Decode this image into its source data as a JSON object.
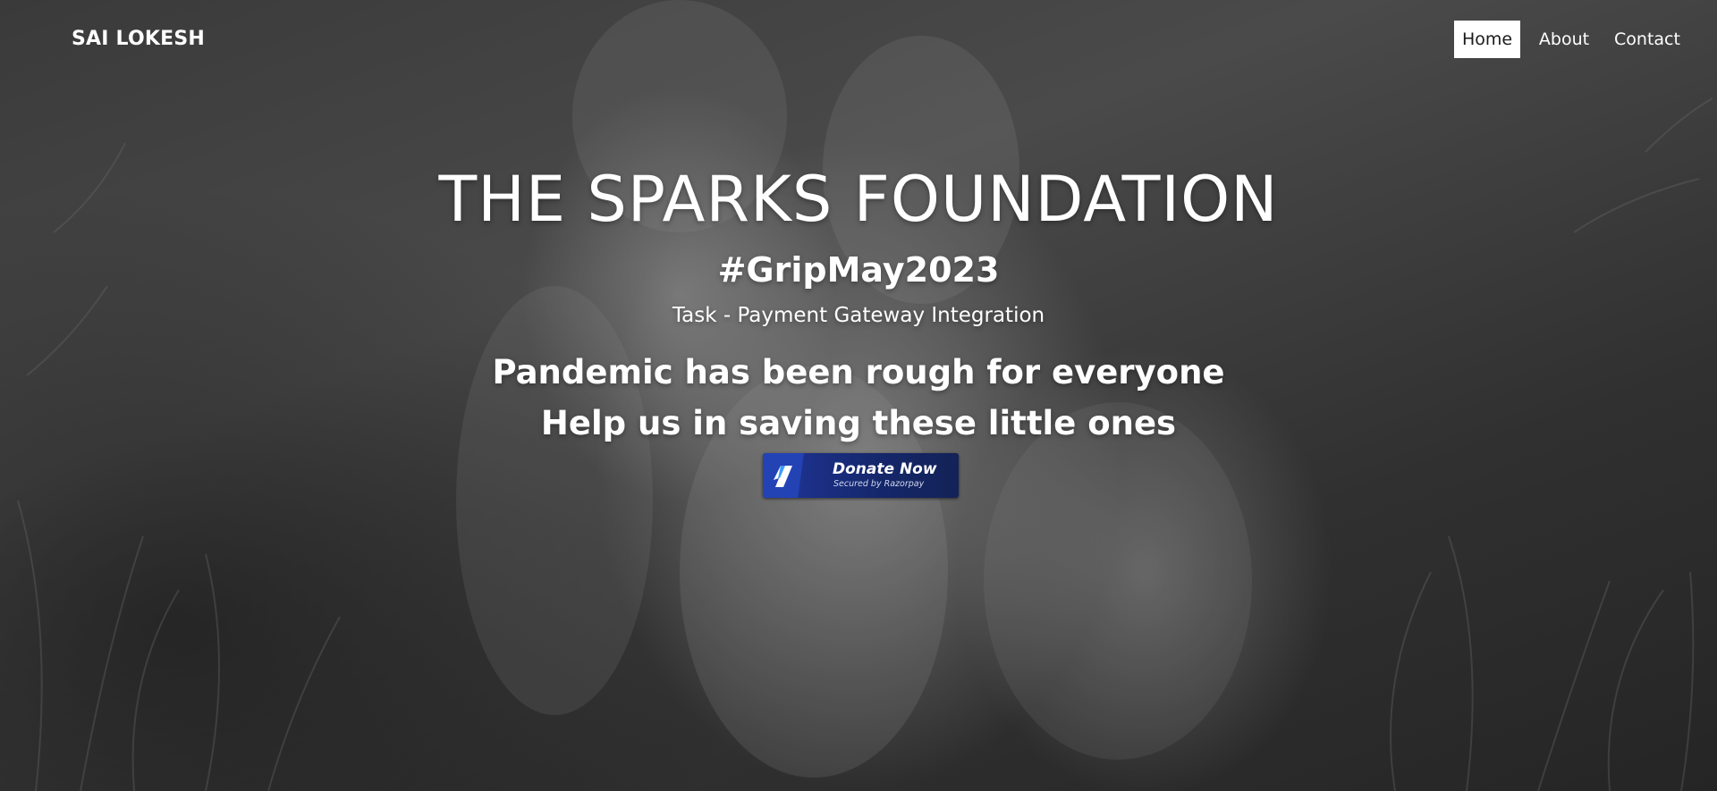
{
  "navbar": {
    "brand": "SAI LOKESH",
    "links": [
      {
        "label": "Home",
        "active": true
      },
      {
        "label": "About",
        "active": false
      },
      {
        "label": "Contact",
        "active": false
      }
    ]
  },
  "hero": {
    "title": "THE SPARKS FOUNDATION",
    "hashtag": "#GripMay2023",
    "task": "Task - Payment Gateway Integration",
    "message_line_1": "Pandemic has been rough for everyone",
    "message_line_2": "Help us in saving these little ones"
  },
  "donate_button": {
    "label": "Donate Now",
    "sublabel": "Secured by Razorpay",
    "icon": "razorpay-logo-icon",
    "color": "#1b2f86"
  },
  "background": {
    "description_icon": "puppies-photo",
    "tone": "grayscale"
  }
}
